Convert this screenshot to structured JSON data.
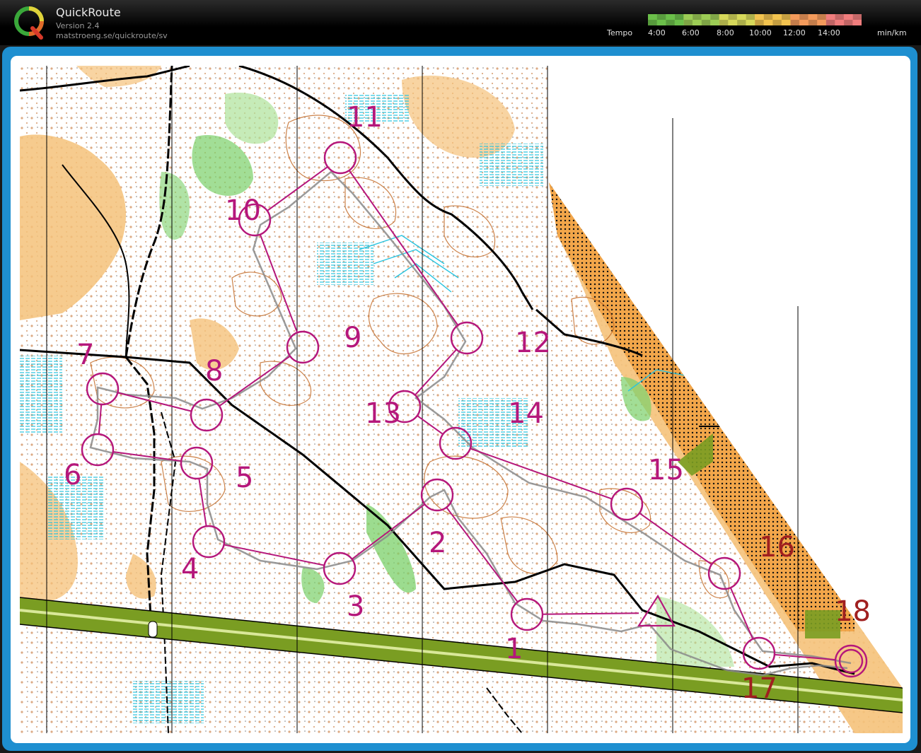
{
  "app": {
    "name": "QuickRoute",
    "version": "Version 2.4",
    "url": "matstroeng.se/quickroute/sv"
  },
  "tempo_scale": {
    "label": "Tempo",
    "ticks": [
      "4:00",
      "6:00",
      "8:00",
      "10:00",
      "12:00",
      "14:00"
    ],
    "unit": "min/km",
    "colors": [
      "#6bbf4a",
      "#9ccc55",
      "#d6d85a",
      "#f2c34f",
      "#f39a5b",
      "#f07d7d"
    ]
  },
  "frame_color": "#1e8fd0",
  "map": {
    "course_color": "#b5177b",
    "control_numbers": [
      "1",
      "2",
      "3",
      "4",
      "5",
      "6",
      "7",
      "8",
      "9",
      "10",
      "11",
      "12",
      "13",
      "14",
      "15",
      "16",
      "17",
      "18"
    ],
    "legend_colors": {
      "open_land": "#f5c27a",
      "green_vegetation": "#7bd06a",
      "marsh": "#27c4e0",
      "contour": "#c0651f",
      "motorway": "#7a9d22",
      "road": "#000000"
    }
  }
}
